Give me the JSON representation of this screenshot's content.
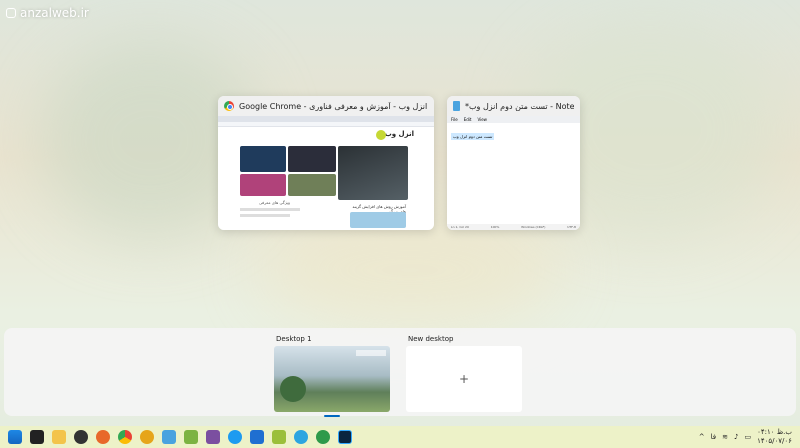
{
  "watermark": {
    "text": "anzalweb.ir"
  },
  "windows": [
    {
      "title": "انزل وب - آموزش و معرفی فناوری - Google Chrome",
      "icon": "chrome-icon"
    },
    {
      "title": "*تست متن دوم انزل وب - Notepad",
      "icon": "notepad-icon"
    }
  ],
  "chrome_preview": {
    "site_name": "انزل وب",
    "article_headline": "آموزش روش های افزایش گزینه های بزرگ",
    "side_text": "ویژگی های معرفی"
  },
  "notepad_preview": {
    "menu": [
      "File",
      "Edit",
      "View"
    ],
    "selected_text": "تست متن دوم انزل وب",
    "status": [
      "Ln 1, Col 20",
      "100%",
      "Windows (CRLF)",
      "UTF-8"
    ]
  },
  "desktops": [
    {
      "label": "Desktop 1",
      "active": true
    },
    {
      "label": "New desktop",
      "plus": "+"
    }
  ],
  "taskbar": {
    "icons": [
      "windows-start-icon",
      "file-explorer-icon",
      "folder-icon",
      "gamepad-icon",
      "firefox-icon",
      "chrome-icon",
      "search-tool-icon",
      "notepad-icon",
      "android-icon",
      "app-icon",
      "browser-icon",
      "writer-icon",
      "game-icon",
      "telegram-icon",
      "app-green-icon",
      "photoshop-icon"
    ],
    "tray": {
      "lang": "فا",
      "time": "۰۴:۱۰ ب.ظ",
      "date": "۱۴۰۵/۰۷/۰۶"
    }
  },
  "colors": {
    "accent": "#0067c0",
    "taskbar": "#edf2c8"
  }
}
